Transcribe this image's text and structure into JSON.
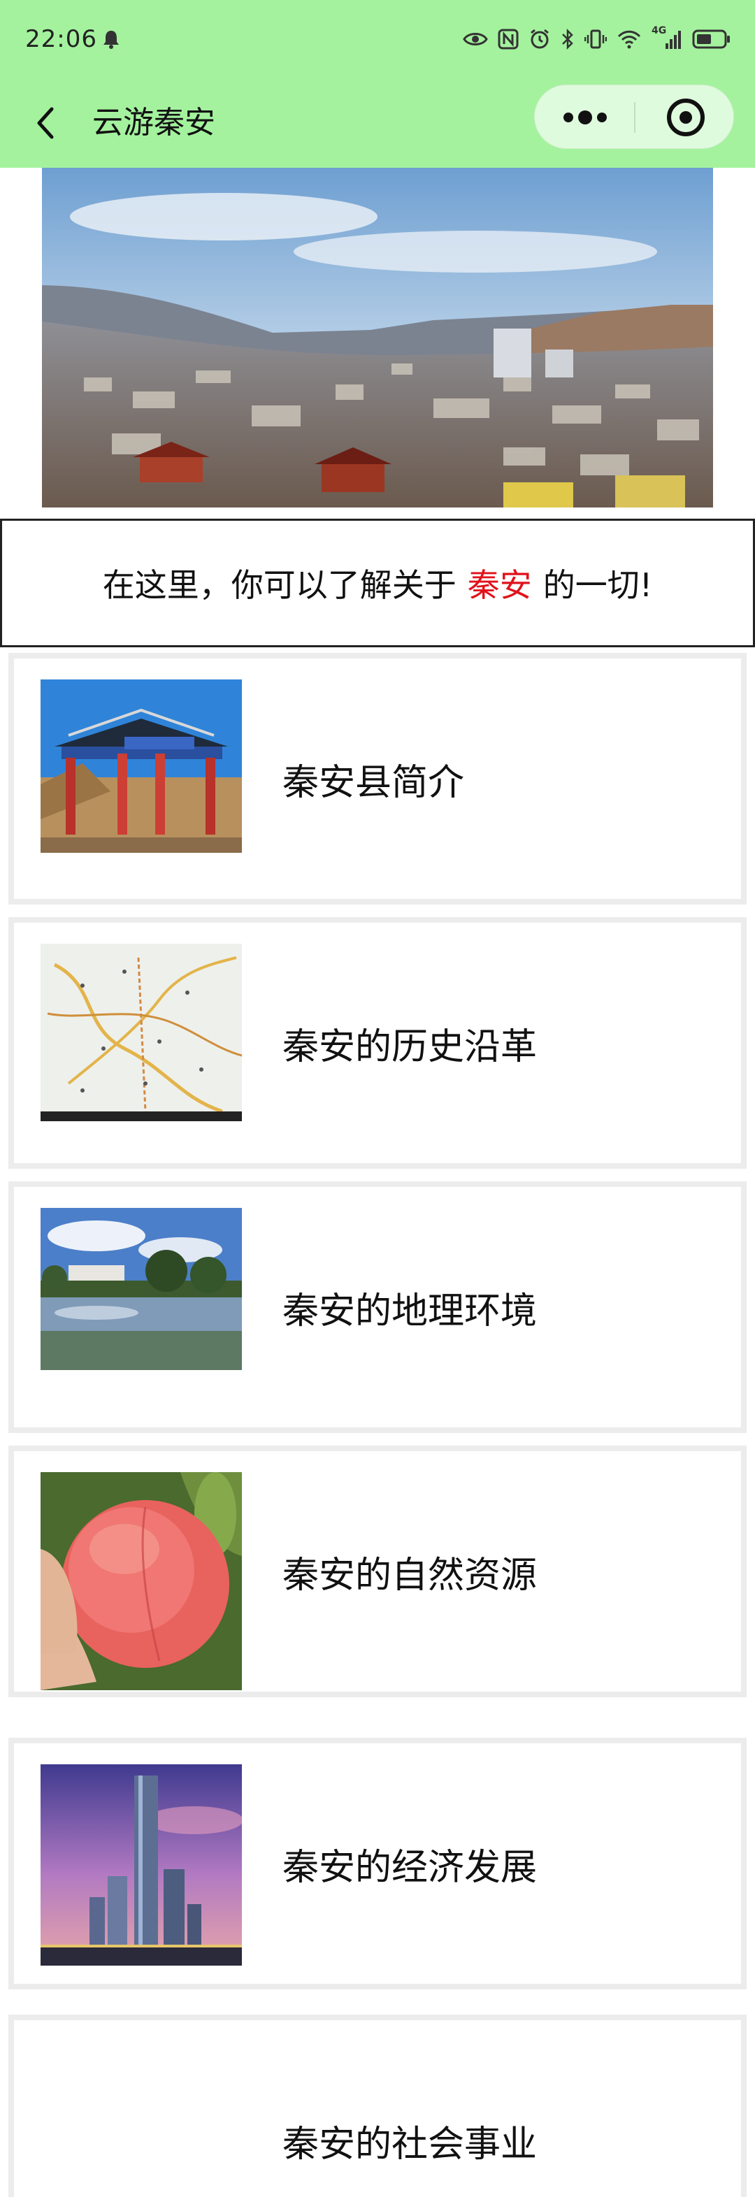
{
  "status_bar": {
    "time": "22:06",
    "network": "4G"
  },
  "nav": {
    "title": "云游秦安"
  },
  "intro": {
    "before": "在这里，你可以了解关于",
    "highlight": "秦安",
    "after": "的一切!"
  },
  "items": [
    {
      "label": "秦安县简介",
      "image": "memorial-archway-photo"
    },
    {
      "label": "秦安的历史沿革",
      "image": "county-map-image"
    },
    {
      "label": "秦安的地理环境",
      "image": "lake-landscape-photo"
    },
    {
      "label": "秦安的自然资源",
      "image": "peach-photo"
    },
    {
      "label": "秦安的经济发展",
      "image": "skyscraper-photo"
    },
    {
      "label": "秦安的社会事业",
      "image": ""
    }
  ],
  "colors": {
    "header_bg": "#a4f29e",
    "highlight": "#e0121b",
    "card_border": "#ececec"
  }
}
